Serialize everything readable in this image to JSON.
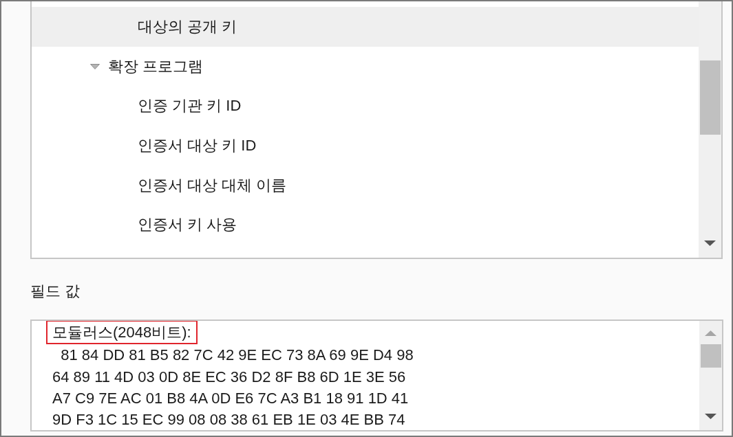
{
  "tree": {
    "items": [
      {
        "children": [
          {
            "label": "대상의 공개 키",
            "selected": true
          }
        ]
      },
      {
        "label": "확장 프로그램",
        "selected": false,
        "expanded": true,
        "children": [
          {
            "label": "인증 기관 키 ID",
            "selected": false
          },
          {
            "label": "인증서 대상 키 ID",
            "selected": false
          },
          {
            "label": "인증서 대상 대체 이름",
            "selected": false
          },
          {
            "label": "인증서 키 사용",
            "selected": false
          }
        ]
      }
    ]
  },
  "field_value": {
    "label": "필드 값",
    "lines": [
      {
        "text": "모듈러스(2048비트):",
        "highlighted": true
      },
      {
        "text": "  81 84 DD 81 B5 82 7C 42 9E EC 73 8A 69 9E D4 98",
        "highlighted": false
      },
      {
        "text": "64 89 11 4D 03 0D 8E EC 36 D2 8F B8 6D 1E 3E 56",
        "highlighted": false
      },
      {
        "text": "A7 C9 7E AC 01 B8 4A 0D E6 7C A3 B1 18 91 1D 41",
        "highlighted": false
      },
      {
        "text": "9D F3 1C 15 EC 99 08 08 38 61 EB 1E 03 4E BB 74",
        "highlighted": false
      }
    ]
  }
}
